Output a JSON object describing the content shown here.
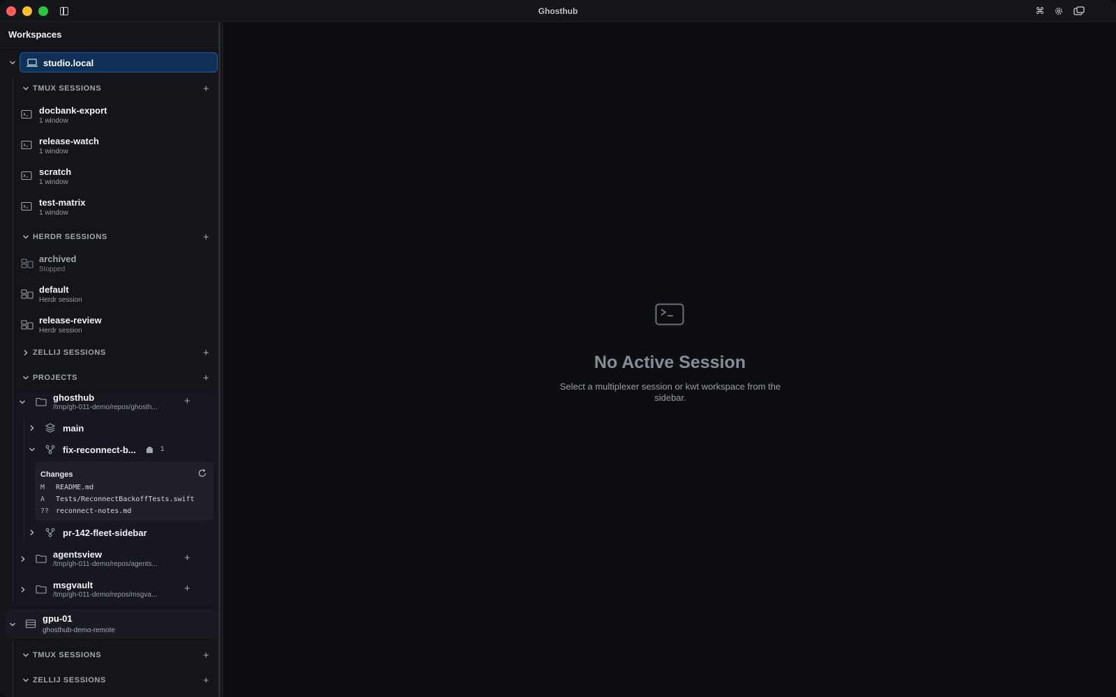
{
  "window": {
    "title": "Ghosthub"
  },
  "sidebar": {
    "heading": "Workspaces",
    "hosts": [
      {
        "name": "studio.local",
        "tmux": {
          "label": "TMUX SESSIONS",
          "sessions": [
            {
              "name": "docbank-export",
              "sub": "1 window"
            },
            {
              "name": "release-watch",
              "sub": "1 window"
            },
            {
              "name": "scratch",
              "sub": "1 window"
            },
            {
              "name": "test-matrix",
              "sub": "1 window"
            }
          ]
        },
        "herdr": {
          "label": "HERDR SESSIONS",
          "sessions": [
            {
              "name": "archived",
              "sub": "Stopped"
            },
            {
              "name": "default",
              "sub": "Herdr session"
            },
            {
              "name": "release-review",
              "sub": "Herdr session"
            }
          ]
        },
        "zellij": {
          "label": "ZELLIJ SESSIONS"
        },
        "projects": {
          "label": "PROJECTS",
          "items": [
            {
              "name": "ghosthub",
              "path": "/tmp/gh-011-demo/repos/ghosth...",
              "branches": [
                {
                  "name": "main"
                },
                {
                  "name": "fix-reconnect-b...",
                  "badge": "1"
                },
                {
                  "name": "pr-142-fleet-sidebar"
                }
              ]
            },
            {
              "name": "agentsview",
              "path": "/tmp/gh-011-demo/repos/agents..."
            },
            {
              "name": "msgvault",
              "path": "/tmp/gh-011-demo/repos/msgva..."
            }
          ],
          "changes": {
            "title": "Changes",
            "files": [
              {
                "status": "M",
                "file": "README.md"
              },
              {
                "status": "A",
                "file": "Tests/ReconnectBackoffTests.swift"
              },
              {
                "status": "??",
                "file": "reconnect-notes.md"
              }
            ]
          }
        }
      },
      {
        "name": "gpu-01",
        "sub": "ghosthub-demo-remote",
        "tmux": {
          "label": "TMUX SESSIONS"
        },
        "zellij": {
          "label": "ZELLIJ SESSIONS"
        }
      }
    ]
  },
  "main": {
    "empty_title": "No Active Session",
    "empty_subtitle": "Select a multiplexer session or kwt workspace from the sidebar."
  },
  "icons": {
    "titlebar": [
      "sidebar-toggle-icon",
      "command-icon",
      "gear-icon",
      "windows-icon"
    ],
    "session": "terminal-icon",
    "herdr": "layout-icon",
    "project": "folder-icon"
  },
  "colors": {
    "background": "#0d0e14",
    "sidebar": "#14151b",
    "selected": "#113058",
    "selected_border": "#2a5a96",
    "close": "#ff5f57",
    "minimize": "#febc2e",
    "maximize": "#28c840"
  }
}
